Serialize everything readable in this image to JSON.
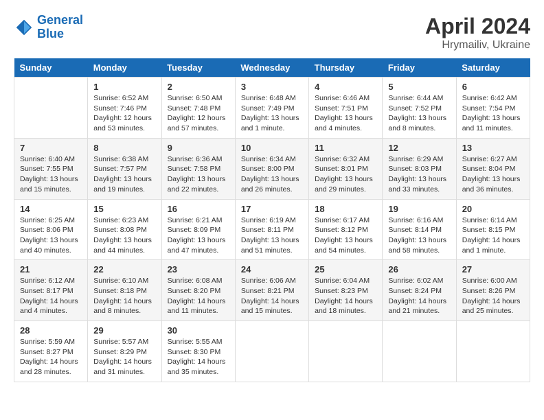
{
  "logo": {
    "line1": "General",
    "line2": "Blue"
  },
  "title": "April 2024",
  "subtitle": "Hrymailiv, Ukraine",
  "days_header": [
    "Sunday",
    "Monday",
    "Tuesday",
    "Wednesday",
    "Thursday",
    "Friday",
    "Saturday"
  ],
  "weeks": [
    [
      {
        "day": "",
        "info": ""
      },
      {
        "day": "1",
        "info": "Sunrise: 6:52 AM\nSunset: 7:46 PM\nDaylight: 12 hours\nand 53 minutes."
      },
      {
        "day": "2",
        "info": "Sunrise: 6:50 AM\nSunset: 7:48 PM\nDaylight: 12 hours\nand 57 minutes."
      },
      {
        "day": "3",
        "info": "Sunrise: 6:48 AM\nSunset: 7:49 PM\nDaylight: 13 hours\nand 1 minute."
      },
      {
        "day": "4",
        "info": "Sunrise: 6:46 AM\nSunset: 7:51 PM\nDaylight: 13 hours\nand 4 minutes."
      },
      {
        "day": "5",
        "info": "Sunrise: 6:44 AM\nSunset: 7:52 PM\nDaylight: 13 hours\nand 8 minutes."
      },
      {
        "day": "6",
        "info": "Sunrise: 6:42 AM\nSunset: 7:54 PM\nDaylight: 13 hours\nand 11 minutes."
      }
    ],
    [
      {
        "day": "7",
        "info": "Sunrise: 6:40 AM\nSunset: 7:55 PM\nDaylight: 13 hours\nand 15 minutes."
      },
      {
        "day": "8",
        "info": "Sunrise: 6:38 AM\nSunset: 7:57 PM\nDaylight: 13 hours\nand 19 minutes."
      },
      {
        "day": "9",
        "info": "Sunrise: 6:36 AM\nSunset: 7:58 PM\nDaylight: 13 hours\nand 22 minutes."
      },
      {
        "day": "10",
        "info": "Sunrise: 6:34 AM\nSunset: 8:00 PM\nDaylight: 13 hours\nand 26 minutes."
      },
      {
        "day": "11",
        "info": "Sunrise: 6:32 AM\nSunset: 8:01 PM\nDaylight: 13 hours\nand 29 minutes."
      },
      {
        "day": "12",
        "info": "Sunrise: 6:29 AM\nSunset: 8:03 PM\nDaylight: 13 hours\nand 33 minutes."
      },
      {
        "day": "13",
        "info": "Sunrise: 6:27 AM\nSunset: 8:04 PM\nDaylight: 13 hours\nand 36 minutes."
      }
    ],
    [
      {
        "day": "14",
        "info": "Sunrise: 6:25 AM\nSunset: 8:06 PM\nDaylight: 13 hours\nand 40 minutes."
      },
      {
        "day": "15",
        "info": "Sunrise: 6:23 AM\nSunset: 8:08 PM\nDaylight: 13 hours\nand 44 minutes."
      },
      {
        "day": "16",
        "info": "Sunrise: 6:21 AM\nSunset: 8:09 PM\nDaylight: 13 hours\nand 47 minutes."
      },
      {
        "day": "17",
        "info": "Sunrise: 6:19 AM\nSunset: 8:11 PM\nDaylight: 13 hours\nand 51 minutes."
      },
      {
        "day": "18",
        "info": "Sunrise: 6:17 AM\nSunset: 8:12 PM\nDaylight: 13 hours\nand 54 minutes."
      },
      {
        "day": "19",
        "info": "Sunrise: 6:16 AM\nSunset: 8:14 PM\nDaylight: 13 hours\nand 58 minutes."
      },
      {
        "day": "20",
        "info": "Sunrise: 6:14 AM\nSunset: 8:15 PM\nDaylight: 14 hours\nand 1 minute."
      }
    ],
    [
      {
        "day": "21",
        "info": "Sunrise: 6:12 AM\nSunset: 8:17 PM\nDaylight: 14 hours\nand 4 minutes."
      },
      {
        "day": "22",
        "info": "Sunrise: 6:10 AM\nSunset: 8:18 PM\nDaylight: 14 hours\nand 8 minutes."
      },
      {
        "day": "23",
        "info": "Sunrise: 6:08 AM\nSunset: 8:20 PM\nDaylight: 14 hours\nand 11 minutes."
      },
      {
        "day": "24",
        "info": "Sunrise: 6:06 AM\nSunset: 8:21 PM\nDaylight: 14 hours\nand 15 minutes."
      },
      {
        "day": "25",
        "info": "Sunrise: 6:04 AM\nSunset: 8:23 PM\nDaylight: 14 hours\nand 18 minutes."
      },
      {
        "day": "26",
        "info": "Sunrise: 6:02 AM\nSunset: 8:24 PM\nDaylight: 14 hours\nand 21 minutes."
      },
      {
        "day": "27",
        "info": "Sunrise: 6:00 AM\nSunset: 8:26 PM\nDaylight: 14 hours\nand 25 minutes."
      }
    ],
    [
      {
        "day": "28",
        "info": "Sunrise: 5:59 AM\nSunset: 8:27 PM\nDaylight: 14 hours\nand 28 minutes."
      },
      {
        "day": "29",
        "info": "Sunrise: 5:57 AM\nSunset: 8:29 PM\nDaylight: 14 hours\nand 31 minutes."
      },
      {
        "day": "30",
        "info": "Sunrise: 5:55 AM\nSunset: 8:30 PM\nDaylight: 14 hours\nand 35 minutes."
      },
      {
        "day": "",
        "info": ""
      },
      {
        "day": "",
        "info": ""
      },
      {
        "day": "",
        "info": ""
      },
      {
        "day": "",
        "info": ""
      }
    ]
  ]
}
